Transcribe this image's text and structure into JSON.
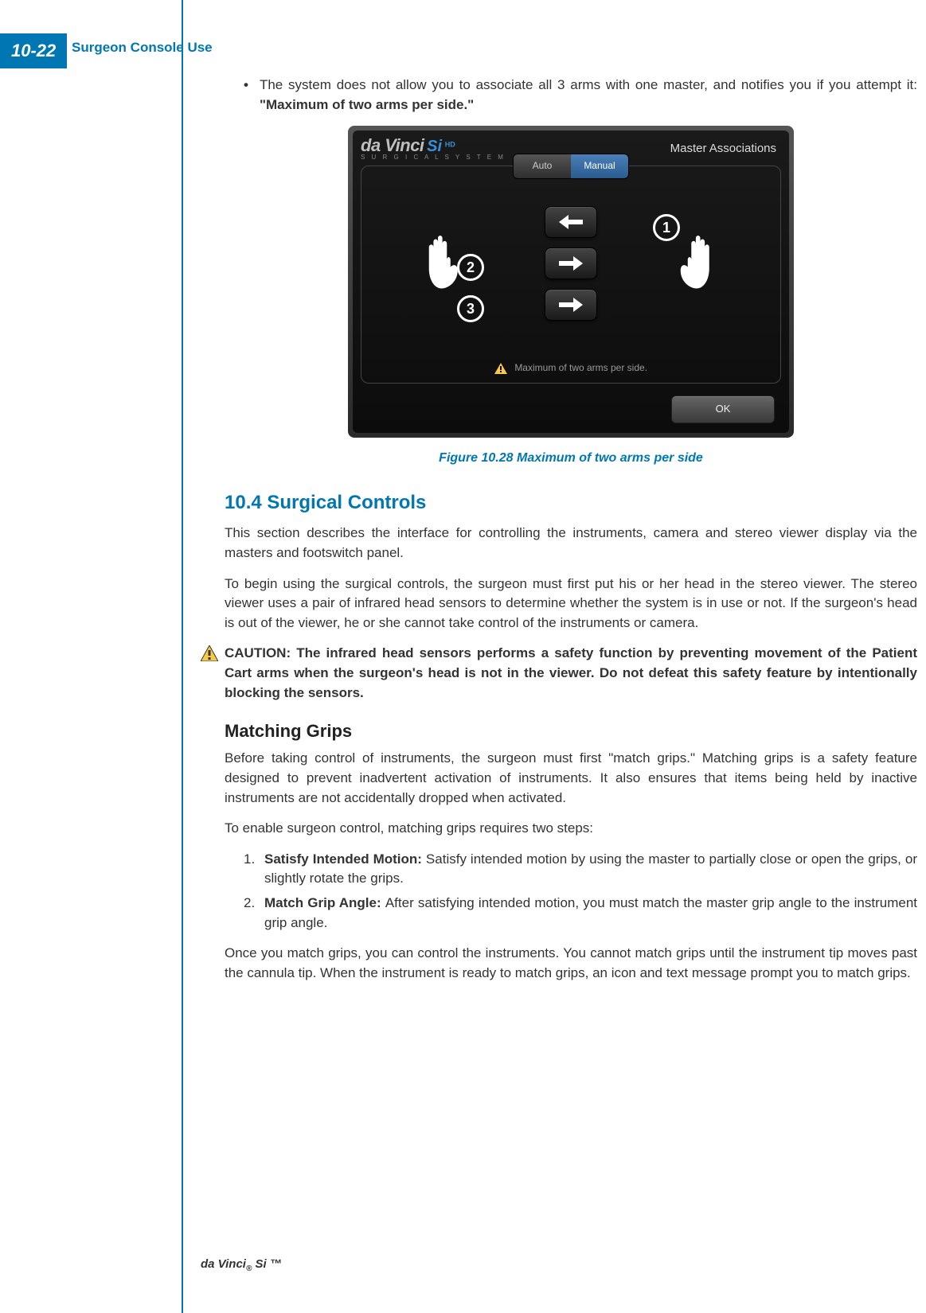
{
  "page_number": "10-22",
  "section_header": "Surgeon Console Use",
  "bullet_intro_a": "The system does not allow you to associate all 3 arms with one master, and notifies you if you attempt it: ",
  "bullet_intro_bold": "\"Maximum of two arms per side.\"",
  "screenshot": {
    "logo_main": "da Vinci",
    "logo_si": "Si",
    "logo_hd": "HD",
    "logo_sub": "S U R G I C A L   S Y S T E M",
    "panel_title": "Master Associations",
    "tab_auto": "Auto",
    "tab_manual": "Manual",
    "num1": "1",
    "num2": "2",
    "num3": "3",
    "warning": "Maximum of two arms per side.",
    "ok": "OK"
  },
  "figure_caption": "Figure 10.28 Maximum of two arms per side",
  "heading_104": "10.4 Surgical Controls",
  "para_104a": "This section describes the interface for controlling the instruments, camera and stereo viewer display via the masters and footswitch panel.",
  "para_104b": "To begin using the surgical controls, the surgeon must first put his or her head in the stereo viewer. The stereo viewer uses a pair of infrared head sensors to determine whether the system is in use or not. If the surgeon's head is out of the viewer, he or she cannot take control of the instruments or camera.",
  "caution_label": "CAUTION:",
  "caution_body": " The infrared head sensors performs a safety function by preventing movement of the Patient Cart arms when the surgeon's head is not in the viewer. Do not defeat this safety feature by intentionally blocking the sensors.",
  "heading_grips": "Matching Grips",
  "para_grips_a": "Before taking control of instruments, the surgeon must first \"match grips.\" Matching grips is a safety feature designed to prevent inadvertent activation of instruments. It also ensures that items being held by inactive instruments are not accidentally dropped when activated.",
  "para_grips_b": "To enable surgeon control, matching grips requires two steps:",
  "step1_num": "1.",
  "step1_bold": "Satisfy Intended Motion: ",
  "step1_body": "Satisfy intended motion by using the master to partially close or open the grips, or slightly rotate the grips.",
  "step2_num": "2.",
  "step2_bold": "Match Grip Angle: ",
  "step2_body": "After satisfying intended motion, you must match the master grip angle to the instrument grip angle.",
  "para_grips_c": "Once you match grips, you can control the instruments. You cannot match grips until the instrument tip moves past the cannula tip. When the instrument is ready to match grips, an icon and text message prompt you to match grips.",
  "footer_a": "da Vinci",
  "footer_reg": "®",
  "footer_b": " Si ™"
}
